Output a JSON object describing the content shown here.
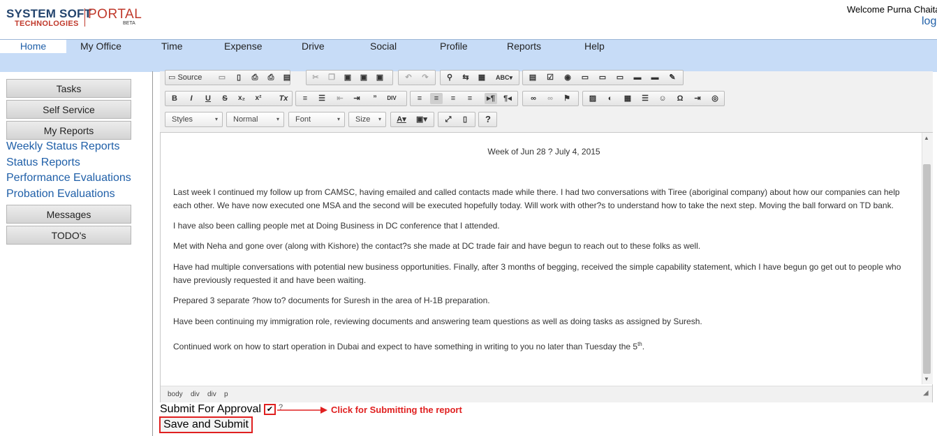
{
  "header": {
    "logo_main": "SYSTEM SOFT",
    "logo_sub": "TECHNOLOGIES",
    "logo_portal": "PORTAL",
    "logo_beta": "BETA",
    "welcome": "Welcome Purna Chaita",
    "logout": "log"
  },
  "nav": [
    "Home",
    "My Office",
    "Time",
    "Expense",
    "Drive",
    "Social",
    "Profile",
    "Reports",
    "Help"
  ],
  "sidebar": {
    "tasks": "Tasks",
    "self_service": "Self Service",
    "my_reports": "My Reports",
    "links": [
      "Weekly Status Reports",
      "Status Reports",
      "Performance Evaluations",
      "Probation Evaluations"
    ],
    "messages": "Messages",
    "todos": "TODO's"
  },
  "toolbar": {
    "source": "Source",
    "styles": "Styles",
    "format": "Normal",
    "font": "Font",
    "size": "Size"
  },
  "content": {
    "heading": "Week of Jun 28 ? July 4, 2015",
    "paragraphs": [
      "Last week I continued my follow up from CAMSC, having emailed and called contacts made while there. I had two conversations with Tiree (aboriginal company) about how our companies can help each other. We have now executed one MSA and the second will be executed hopefully today. Will work with other?s to understand how to take the next step. Moving the ball forward on TD bank.",
      "I have also been calling people met at Doing Business in DC conference that I attended.",
      "Met with Neha and gone over (along with Kishore) the contact?s she made at DC trade fair and have begun to reach out to these folks as well.",
      "Have had multiple conversations with potential new business opportunities. Finally, after 3 months of begging, received the simple capability statement, which I have begun go get out to people who have previously requested it and have been waiting.",
      "Prepared 3 separate ?how to? documents for Suresh in the area of H-1B preparation.",
      "Have been continuing my immigration role, reviewing documents and answering team questions as well as doing tasks as assigned by Suresh.",
      "Continued work on how to start operation in Dubai and expect to have something in writing to you no later than Tuesday the 5"
    ],
    "sup": "th",
    "period": "."
  },
  "pathbar": [
    "body",
    "div",
    "div",
    "p"
  ],
  "form": {
    "approval_label": "Submit For Approval",
    "approval_checked": true,
    "help_mark": "?",
    "save_label": "Save and Submit"
  },
  "annotation": {
    "text": "Click for Submitting the report",
    "color": "#e02020"
  }
}
